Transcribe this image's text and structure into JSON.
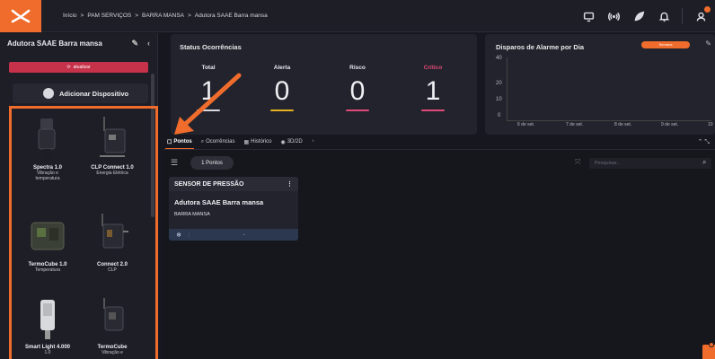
{
  "breadcrumb": {
    "items": [
      "Início",
      ">",
      "PAM SERVIÇOS",
      ">",
      "BARRA MANSA",
      ">",
      "Adutora SAAE Barra mansa"
    ]
  },
  "sidebar": {
    "title": "Adutora SAAE Barra mansa",
    "refresh_label": "atualizar",
    "add_device_label": "Adicionar Dispositivo",
    "devices": [
      {
        "name": "Spectra 1.0",
        "sub": [
          "Vibração e",
          "temperatura"
        ]
      },
      {
        "name": "CLP Connect 1.0",
        "sub": [
          "Energia Elétrica"
        ]
      },
      {
        "name": "TermoCube 1.0",
        "sub": [
          "Temperatura"
        ]
      },
      {
        "name": "Connect 2.0",
        "sub": [
          "CLP"
        ]
      },
      {
        "name": "Smart Light 4.000",
        "sub": [
          "1.0"
        ]
      },
      {
        "name": "TermoCube",
        "sub": [
          "Vibração e"
        ]
      }
    ]
  },
  "status": {
    "title": "Status Ocorrências",
    "columns": [
      {
        "label": "Total",
        "value": "1",
        "color": "#d9d9df"
      },
      {
        "label": "Alerta",
        "value": "0",
        "color": "#e6b120"
      },
      {
        "label": "Risco",
        "value": "0",
        "color": "#e04a78"
      },
      {
        "label": "Crítico",
        "value": "1",
        "color": "#e04a78"
      }
    ]
  },
  "alarm": {
    "title": "Disparos de Alarme por Dia",
    "filter_label": "Semana",
    "y_ticks": [
      "40",
      "20",
      "10",
      "0"
    ],
    "x_ticks": [
      "6 de set.",
      "7 de set.",
      "8 de set.",
      "9 de set.",
      "10"
    ]
  },
  "tabs": [
    {
      "label": "Pontos",
      "icon": "square-icon"
    },
    {
      "label": "Ocorrências",
      "icon": "search-icon"
    },
    {
      "label": "Histórico",
      "icon": "calendar-icon"
    },
    {
      "label": "3D/2D",
      "icon": "cube-icon"
    }
  ],
  "filter": {
    "points_label": "1 Pontos",
    "search_placeholder": "Pesquisar..."
  },
  "sensor_card": {
    "header": "SENSOR DE PRESSÃO",
    "name": "Adutora SAAE Barra mansa",
    "city": "BARRA MANSA",
    "value": "-"
  },
  "colors": {
    "accent": "#ef6c2c",
    "critical": "#c7324b"
  }
}
